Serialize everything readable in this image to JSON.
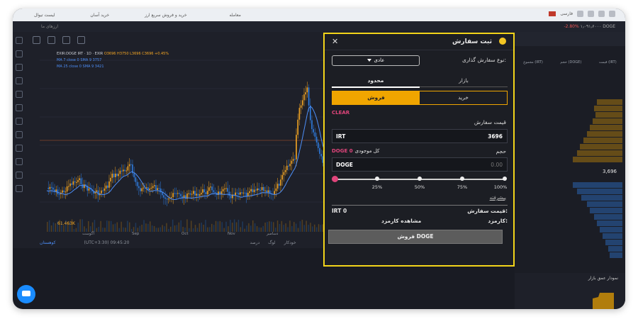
{
  "topnav": {
    "items": [
      "لیست تیوال",
      "خرید آسان",
      "خرید و فروش سریع ارز",
      "معامله"
    ],
    "lang": "فارسی"
  },
  "subbar": {
    "favorites": "ارزهای ما",
    "price": "۱٫۰۹۱٫۶۰۰۰ DOGE",
    "change": "-2.80%"
  },
  "chart": {
    "symbol_line": "EXIR:DOGE IRT · 1D · EXIR",
    "ohlc": "O3696 H3750 L3696 C3696 +0.45%",
    "ma1": "MA 7 close 0 SMA 9  3757",
    "ma2": "MA 25 close 0 SMA 9  3421",
    "price_label": "61.463K",
    "months": [
      "آگوست",
      "Sep",
      "Oct",
      "Nov",
      "دسامبر"
    ],
    "status_left": "کوهستان",
    "status_mid": "(UTC+3:30) 09:45:20",
    "status_right": [
      "درصد",
      "لوگ",
      "خودکار"
    ],
    "colors": {
      "up": "#f5a623",
      "down": "#2f7de1",
      "ma": "#4d8ef7"
    }
  },
  "orderbook": {
    "cols": [
      "قیمت (IRT)",
      "حجم (DOGE)",
      "مجموع (IRT)"
    ],
    "mid": "3,696",
    "depth_title": "نمودار عمق بازار"
  },
  "modal": {
    "title": "ثبت سفارش",
    "order_type_label": "نوع سفارش گذاری:",
    "order_type_value": "عادی",
    "tab_market": "بازار",
    "tab_limit": "محدود",
    "buy_label": "خرید",
    "sell_label": "فروش",
    "clear_label": "CLEAR",
    "price_label": "قیمت سفارش",
    "price_unit": "IRT",
    "price_value": "3696",
    "volume_label": "حجم",
    "available_label": "کل موجودی",
    "available_value": "DOGE 0",
    "volume_unit": "DOGE",
    "volume_placeholder": "0.00",
    "slider_ticks": [
      "25%",
      "50%",
      "75%",
      "100%"
    ],
    "advanced_label": "پیشرفته",
    "order_price_key": "قیمت سفارش:",
    "order_price_val": "IRT 0",
    "fee_key": "کارمزد:",
    "fee_val": "مشاهده کارمزد",
    "submit_label": "فروش DOGE",
    "highlight_color": "#f2d41a"
  }
}
